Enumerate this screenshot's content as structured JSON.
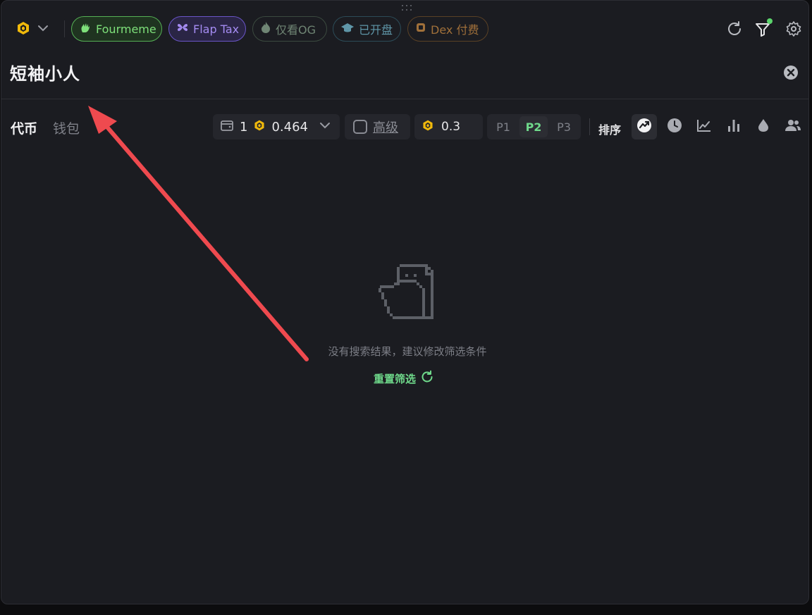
{
  "chain": {
    "icon": "bnb-icon"
  },
  "chips": [
    {
      "label": "Fourmeme",
      "icon": "hand-icon",
      "color": "#7ee07a"
    },
    {
      "label": "Flap Tax",
      "icon": "butterfly-icon",
      "color": "#a58cf2"
    },
    {
      "label": "仅看OG",
      "icon": "flame-icon",
      "color": "#6f8574"
    },
    {
      "label": "已开盘",
      "icon": "graduation-cap-icon",
      "color": "#5f96a8"
    },
    {
      "label": "Dex 付费",
      "icon": "dex-icon",
      "color": "#a0703a"
    }
  ],
  "search": {
    "value": "短袖小人"
  },
  "tabs": [
    {
      "label": "代币",
      "active": true
    },
    {
      "label": "钱包",
      "active": false
    }
  ],
  "wallet": {
    "count": "1",
    "amount": "0.464"
  },
  "advanced": {
    "label": "高级",
    "checked": false
  },
  "gas": {
    "value": "0.3"
  },
  "presets": [
    "P1",
    "P2",
    "P3"
  ],
  "active_preset": "P2",
  "sort": {
    "label": "排序",
    "options": [
      "trending-icon",
      "clock-icon",
      "line-chart-icon",
      "bar-chart-icon",
      "liquidity-drop-icon",
      "holders-icon"
    ]
  },
  "empty": {
    "message": "没有搜索结果，建议修改筛选条件",
    "reset_label": "重置筛选"
  },
  "colors": {
    "accent": "#6fd98b",
    "annotation": "#ef4a4f"
  }
}
